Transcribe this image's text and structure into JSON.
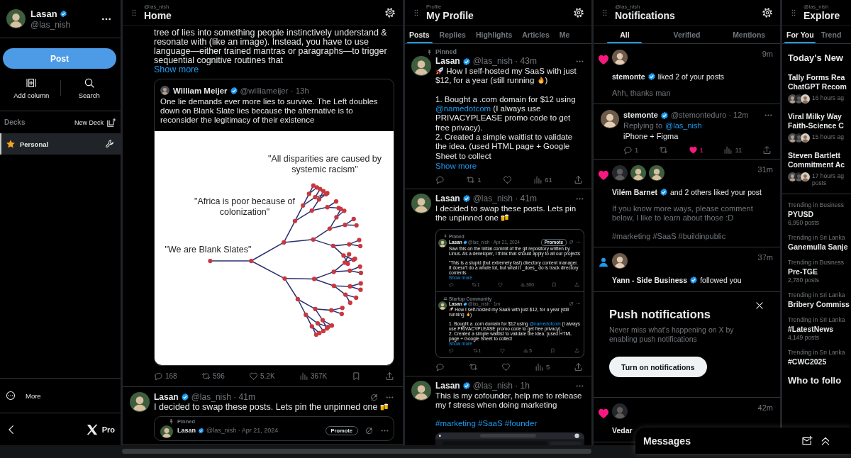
{
  "sidebar": {
    "user": {
      "name": "Lasan",
      "verified": true,
      "handle": "@las_nish"
    },
    "post_button": "Post",
    "actions": [
      {
        "kind": "add_column",
        "label": "Add column"
      },
      {
        "kind": "search",
        "label": "Search"
      }
    ],
    "decks_title": "Decks",
    "new_deck": "New Deck",
    "decks": [
      {
        "label": "Personal",
        "selected": true
      }
    ],
    "more": "More",
    "brand": "Pro"
  },
  "home": {
    "subtitle": "@las_nish",
    "title": "Home",
    "posts": [
      {
        "paragraphs": [
          [
            {
              "kind": "text",
              "text": "tree of lies into something people instinctively understand & resonate with (like an image). Instead, you have to use language—either trained mantras or paragraphs—to trigger sequential cognitive routines that"
            }
          ]
        ],
        "show_more": "Show more",
        "quote": {
          "author": {
            "name": "William Meijer",
            "verified": true,
            "meta": "@williameijer · 13h"
          },
          "text": "One lie demands ever more lies to survive. The Left doubles down on Blank Slate lies because the alternative is to reconsider the legitimacy of their existence",
          "diagram": {
            "labels": [
              "\"All disparities are caused by systemic racism\"",
              "\"Africa is poor because of colonization\"",
              "\"We are Blank Slates\""
            ]
          }
        },
        "stats": [
          {
            "kind": "reply",
            "count": "168"
          },
          {
            "kind": "repost",
            "count": "596"
          },
          {
            "kind": "like",
            "count": "5.2K"
          },
          {
            "kind": "views",
            "count": "367K"
          },
          {
            "kind": "bookmark"
          },
          {
            "kind": "share"
          }
        ]
      },
      {
        "kind": "hideable",
        "author": {
          "name": "Lasan",
          "verified": true,
          "meta": "@las_nish · 41m"
        },
        "paragraphs": [
          [
            {
              "kind": "text",
              "text": "I decided to swap these posts. Lets pin the unpinned one "
            },
            {
              "kind": "beer"
            }
          ]
        ],
        "quoted_post": {
          "kind": "hideable",
          "context": {
            "kind": "pinned",
            "label": "Pinned"
          },
          "author": {
            "name": "Lasan",
            "verified": true,
            "meta": "@las_nish · Apr 21, 2024"
          },
          "promote": "Promote"
        }
      }
    ]
  },
  "profile": {
    "subtitle": "Profile",
    "title": "My Profile",
    "tabs": [
      {
        "label": "Posts",
        "selected": true
      },
      {
        "label": "Replies",
        "selected": false
      },
      {
        "label": "Highlights",
        "selected": false
      },
      {
        "label": "Articles",
        "selected": false
      },
      {
        "label": "Me",
        "selected": false
      }
    ],
    "posts": [
      {
        "kind": "plain",
        "context": {
          "kind": "pinned",
          "label": "Pinned"
        },
        "author": {
          "name": "Lasan",
          "verified": true,
          "meta": "@las_nish · 43m"
        },
        "paragraphs": [
          [
            {
              "kind": "rocket"
            },
            {
              "kind": "text",
              "text": " How I self-hosted my SaaS with just $12, for a year (still running "
            },
            {
              "kind": "fire"
            },
            {
              "kind": "text",
              "text": ")"
            }
          ],
          [
            {
              "kind": "text",
              "text": "1. Bought a .com domain for $12 using "
            },
            {
              "kind": "link",
              "text": "@namedotcom"
            },
            {
              "kind": "text",
              "text": " (I always use PRIVACYPLEASE promo code to get free privacy)."
            },
            {
              "kind": "break"
            },
            {
              "kind": "text",
              "text": "2. Created a simple waitlist to validate the idea. (used HTML page + Google Sheet to collect"
            }
          ]
        ],
        "show_more": "Show more",
        "stats": [
          {
            "kind": "reply"
          },
          {
            "kind": "repost",
            "count": "1"
          },
          {
            "kind": "like"
          },
          {
            "kind": "views",
            "count": "61"
          },
          {
            "kind": "share"
          }
        ]
      },
      {
        "kind": "plain",
        "author": {
          "name": "Lasan",
          "verified": true,
          "meta": "@las_nish · 41m"
        },
        "paragraphs": [
          [
            {
              "kind": "text",
              "text": "I decided to swap these posts. Lets pin the unpinned one "
            },
            {
              "kind": "beer"
            }
          ]
        ],
        "embed": {
          "posts": [
            {
              "kind": "hideable",
              "context": {
                "kind": "pinned",
                "label": "Pinned"
              },
              "author": {
                "name": "Lasan",
                "verified": true,
                "meta": "@las_nish · Apr 21, 2024"
              },
              "promote": "Promote",
              "paragraphs": [
                [
                  {
                    "kind": "text",
                    "text": "Saw this on the initial commit of the git repository written by Linus. As a developer, I think that should apply to all our projects"
                  }
                ],
                [
                  {
                    "kind": "text",
                    "text": "\"This is a stupid (but extremely fast) directory content manager.  It doesn't do a whole lot, but what it _does_ do is track directory contents"
                  }
                ]
              ],
              "show_more": "Show more",
              "stats": [
                {
                  "kind": "reply"
                },
                {
                  "kind": "repost",
                  "count": "1"
                },
                {
                  "kind": "like"
                },
                {
                  "kind": "views",
                  "count": "300"
                },
                {
                  "kind": "bookmark"
                },
                {
                  "kind": "share"
                }
              ]
            },
            {
              "kind": "hideable",
              "context": {
                "kind": "community",
                "label": "Startup Community"
              },
              "author": {
                "name": "Lasan",
                "verified": true,
                "meta": "@las_nish · 1m"
              },
              "paragraphs": [
                [
                  {
                    "kind": "rocket"
                  },
                  {
                    "kind": "text",
                    "text": " How I self-hosted my SaaS with just $12, for a year (still running "
                  },
                  {
                    "kind": "fire"
                  },
                  {
                    "kind": "text",
                    "text": ")"
                  }
                ],
                [
                  {
                    "kind": "text",
                    "text": "1. Bought a .com domain for $12 using "
                  },
                  {
                    "kind": "link",
                    "text": "@namedotcom"
                  },
                  {
                    "kind": "text",
                    "text": " (I always use PRIVACYPLEASE promo code to get free privacy)."
                  },
                  {
                    "kind": "break"
                  },
                  {
                    "kind": "text",
                    "text": "2. Created a simple waitlist to validate the idea. (used HTML page + Google Sheet to collect"
                  }
                ]
              ],
              "show_more": "Show more",
              "stats": [
                {
                  "kind": "reply"
                },
                {
                  "kind": "repost",
                  "count": "1"
                },
                {
                  "kind": "like"
                },
                {
                  "kind": "views",
                  "count": "5"
                },
                {
                  "kind": "bookmark"
                },
                {
                  "kind": "share"
                }
              ]
            }
          ]
        },
        "stats": [
          {
            "kind": "reply"
          },
          {
            "kind": "repost"
          },
          {
            "kind": "like"
          },
          {
            "kind": "views",
            "count": "5"
          },
          {
            "kind": "share"
          }
        ]
      },
      {
        "kind": "plain",
        "author": {
          "name": "Lasan",
          "verified": true,
          "meta": "@las_nish · 1h"
        },
        "paragraphs": [
          [
            {
              "kind": "text",
              "text": "This is my cofounder, help me to release my f stress when doing marketing"
            }
          ]
        ],
        "hashtags": [
          "#marketing",
          "#SaaS",
          "#founder"
        ],
        "media": {
          "kind": "picture"
        }
      }
    ]
  },
  "notifications": {
    "subtitle": "@las_nish",
    "title": "Notifications",
    "tabs": [
      {
        "label": "All",
        "selected": true
      },
      {
        "label": "Verified",
        "selected": false
      },
      {
        "label": "Mentions",
        "selected": false
      }
    ],
    "items": [
      {
        "kind": "like",
        "time": "9m",
        "avatars": [
          {
            "kind": "picture"
          }
        ],
        "actor": "stemonte",
        "verified": true,
        "action": "liked 2 of your posts",
        "snippet": [
          "Ahh, thanks man"
        ]
      },
      {
        "kind": "post",
        "post": {
          "kind": "plain",
          "author": {
            "name": "stemonte",
            "verified": true,
            "meta": "@stemonteduro · 12m"
          },
          "replying": {
            "label": "Replying to",
            "mention": "@las_nish"
          },
          "paragraphs": [
            [
              {
                "kind": "text",
                "text": "iPhone + Figma"
              }
            ]
          ],
          "stats": [
            {
              "kind": "reply",
              "count": "1"
            },
            {
              "kind": "repost"
            },
            {
              "kind": "like",
              "count": "1",
              "liked": true
            },
            {
              "kind": "views",
              "count": "11"
            },
            {
              "kind": "share"
            }
          ]
        }
      },
      {
        "kind": "like",
        "time": "31m",
        "avatars": [
          {
            "kind": "picture"
          },
          {
            "kind": "picture"
          },
          {
            "kind": "picture"
          }
        ],
        "actor": "Vilém Barnet",
        "verified": true,
        "action": "and 2 others liked your post",
        "snippet": [
          "If you know more ways, please comment below, I like to learn about those :D",
          "#marketing #SaaS #buildinpublic"
        ]
      },
      {
        "kind": "follow",
        "time": "37m",
        "avatars": [
          {
            "kind": "picture"
          }
        ],
        "actor": "Yann - Side Business",
        "verified": true,
        "action": "followed you"
      },
      {
        "kind": "prompt",
        "title": "Push notifications",
        "text": "Never miss what’s happening on X by enabling push notifications",
        "button": "Turn on notifications"
      },
      {
        "kind": "like",
        "time": "42m",
        "avatars": [
          {
            "kind": "picture"
          }
        ],
        "actor": "Vedar"
      }
    ]
  },
  "explore": {
    "subtitle": "@las_nish",
    "title": "Explore",
    "tabs": [
      {
        "label": "For You",
        "selected": true
      },
      {
        "label": "Trend",
        "selected": false
      }
    ],
    "heading": "Today's New",
    "news": [
      {
        "title_lines": [
          "Tally Forms Rea",
          "ChatGPT Recom"
        ],
        "avatars": [
          {
            "kind": "picture"
          },
          {
            "kind": "picture"
          },
          {
            "kind": "picture"
          }
        ],
        "meta_lines": [
          "16 hours ag"
        ]
      },
      {
        "title_lines": [
          "Viral Milky Way",
          "Faith-Science C"
        ],
        "avatars": [
          {
            "kind": "picture"
          },
          {
            "kind": "picture"
          },
          {
            "kind": "picture"
          }
        ],
        "meta_lines": [
          "15 hours ag"
        ]
      },
      {
        "title_lines": [
          "Steven Bartlett",
          "Commitment Ac"
        ],
        "avatars": [
          {
            "kind": "picture"
          },
          {
            "kind": "picture"
          },
          {
            "kind": "picture"
          }
        ],
        "meta_lines": [
          "17 hours ag",
          "posts"
        ]
      }
    ],
    "trends": [
      {
        "context": "Trending in Business",
        "name": "PYUSD",
        "count": "6,950 posts"
      },
      {
        "context": "Trending in Sri Lanka",
        "name": "Ganemulla Sanje"
      },
      {
        "context": "Trending in Business",
        "name": "Pre-TGE",
        "count": "2,780 posts"
      },
      {
        "context": "Trending in Sri Lanka",
        "name": "Bribery Commiss"
      },
      {
        "context": "Trending in Sri Lanka",
        "name": "#LatestNews",
        "count": "4,149 posts"
      },
      {
        "context": "Trending in Sri Lanka",
        "name": "#CWC2025"
      }
    ],
    "footer_heading": "Who to follo"
  },
  "messages": {
    "title": "Messages"
  }
}
